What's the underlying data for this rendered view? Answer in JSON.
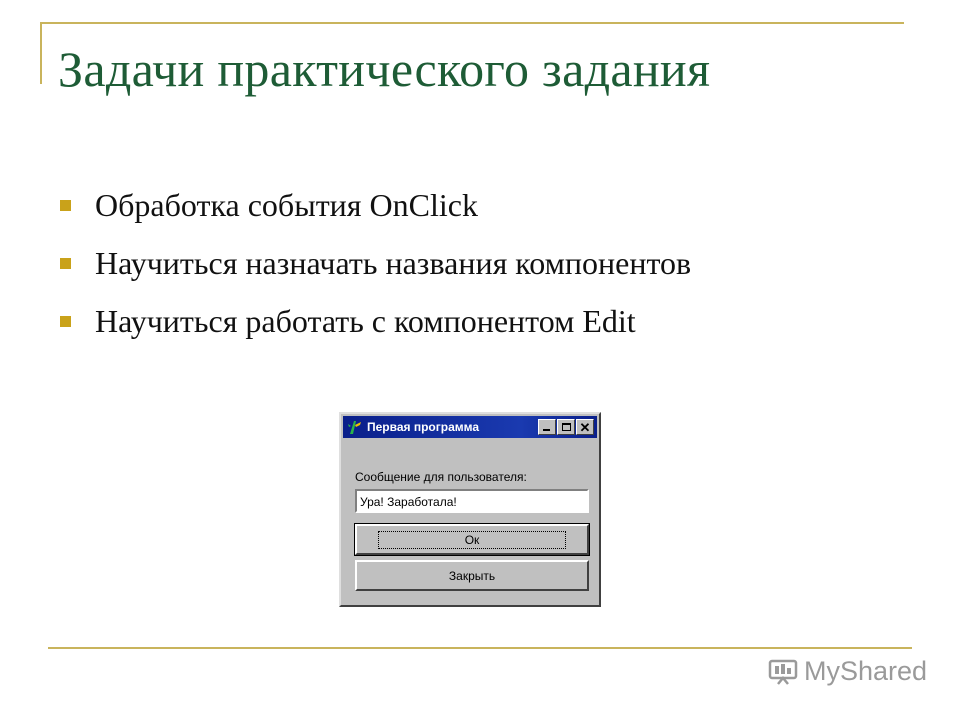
{
  "slide": {
    "title": "Задачи практического задания",
    "bullets": [
      "Обработка события OnClick",
      "Научиться назначать названия компонентов",
      "Научиться работать с компонентом Edit"
    ]
  },
  "dialog": {
    "title": "Первая программа",
    "field_label": "Сообщение для пользователя:",
    "edit_value": "Ура! Заработала!",
    "ok_label": "Ок",
    "close_label": "Закрыть",
    "close_glyph": "✕"
  },
  "watermark": {
    "text": "MyShared"
  },
  "colors": {
    "title": "#1e5c36",
    "accent_rule": "#c9b45c",
    "bullet": "#c9a21a",
    "titlebar": "#0a1f8a",
    "window_face": "#c0c0c0"
  },
  "icons": [
    "bullet-square-icon",
    "app-icon",
    "minimize-icon",
    "maximize-icon",
    "close-icon",
    "myshared-logo-icon"
  ]
}
